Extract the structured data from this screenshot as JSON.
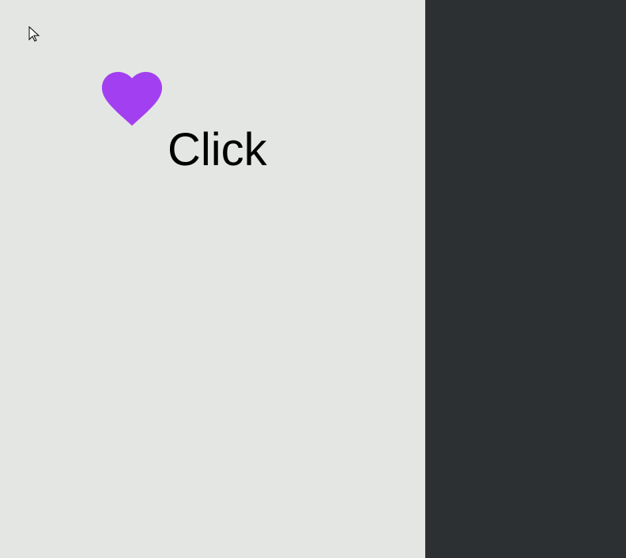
{
  "canvas": {
    "background": "#e4e6e3",
    "side_panel_color": "#2d3033"
  },
  "cursor": {
    "icon": "pointer-arrow-icon",
    "color": "#000000"
  },
  "heart": {
    "icon": "heart-icon",
    "color": "#a23ff0"
  },
  "label": {
    "text": "Click"
  }
}
